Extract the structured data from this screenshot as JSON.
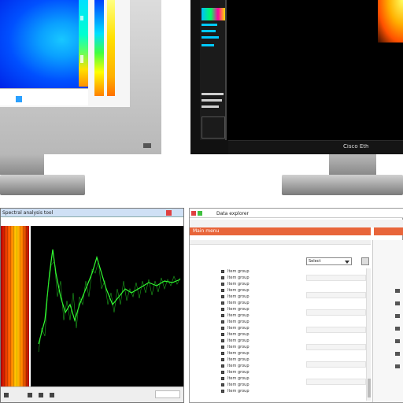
{
  "top_right_monitor": {
    "brand_label": "Cisco Eth"
  },
  "bottom_left_window": {
    "title": "Spectral analysis tool"
  },
  "bottom_right_window": {
    "title": "Data explorer",
    "toolbar_label": "Main menu",
    "combo_value": "Select",
    "tree_items": [
      "Item group",
      "Item group",
      "Item group",
      "Item group",
      "Item group",
      "Item group",
      "Item group",
      "Item group",
      "Item group",
      "Item group",
      "Item group",
      "Item group",
      "Item group",
      "Item group",
      "Item group",
      "Item group",
      "Item group",
      "Item group",
      "Item group",
      "Item group"
    ]
  },
  "colors": {
    "titlebar_accent": "#e8653a",
    "trace": "#33ff33"
  }
}
